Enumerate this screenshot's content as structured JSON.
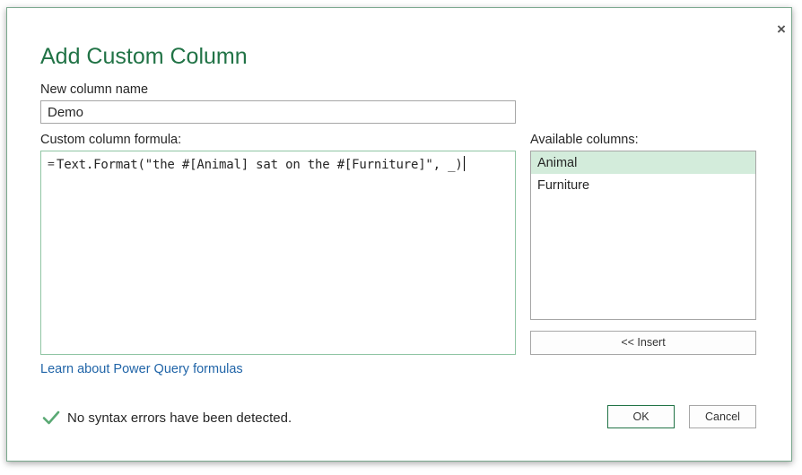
{
  "dialog": {
    "title": "Add Custom Column",
    "close_glyph": "×"
  },
  "name_field": {
    "label": "New column name",
    "value": "Demo"
  },
  "formula_field": {
    "label": "Custom column formula:",
    "prefix": "=",
    "value": "Text.Format(\"the #[Animal] sat on the #[Furniture]\", _)"
  },
  "available_columns": {
    "label": "Available columns:",
    "items": [
      "Animal",
      "Furniture"
    ],
    "selected": "Animal"
  },
  "buttons": {
    "insert": "<< Insert",
    "ok": "OK",
    "cancel": "Cancel"
  },
  "link": {
    "learn": "Learn about Power Query formulas"
  },
  "status": {
    "message": "No syntax errors have been detected.",
    "icon": "check-icon"
  },
  "colors": {
    "accent": "#217346",
    "selection": "#d3ecdb",
    "link": "#2165a8",
    "check": "#5aa974"
  }
}
